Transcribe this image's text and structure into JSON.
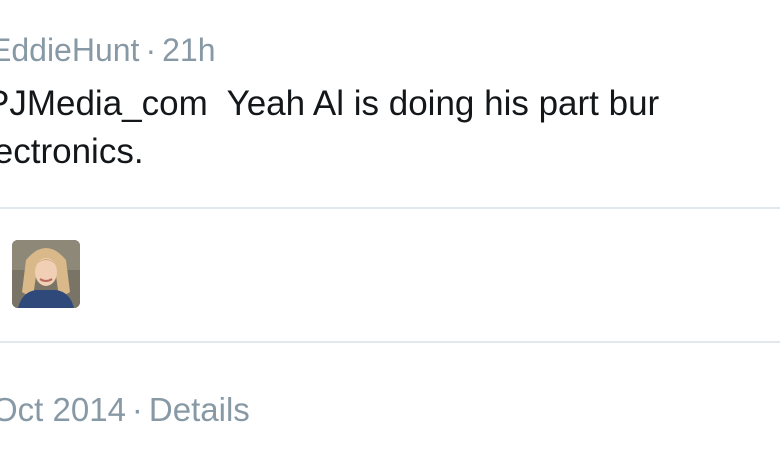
{
  "header": {
    "username": "EddieHunt",
    "separator": "·",
    "timestamp": "21h"
  },
  "tweet": {
    "line1_mention": "PJMedia_com",
    "line1_text": "  Yeah Al is doing his part bur",
    "line2_text": "lectronics."
  },
  "favorited_by": {
    "avatar_icon": "user-avatar-icon"
  },
  "footer": {
    "date": "Oct 2014",
    "separator": "·",
    "details_label": "Details"
  },
  "colors": {
    "meta_gray": "#8899a6",
    "text": "#14171a",
    "divider": "#e1e8ed"
  }
}
